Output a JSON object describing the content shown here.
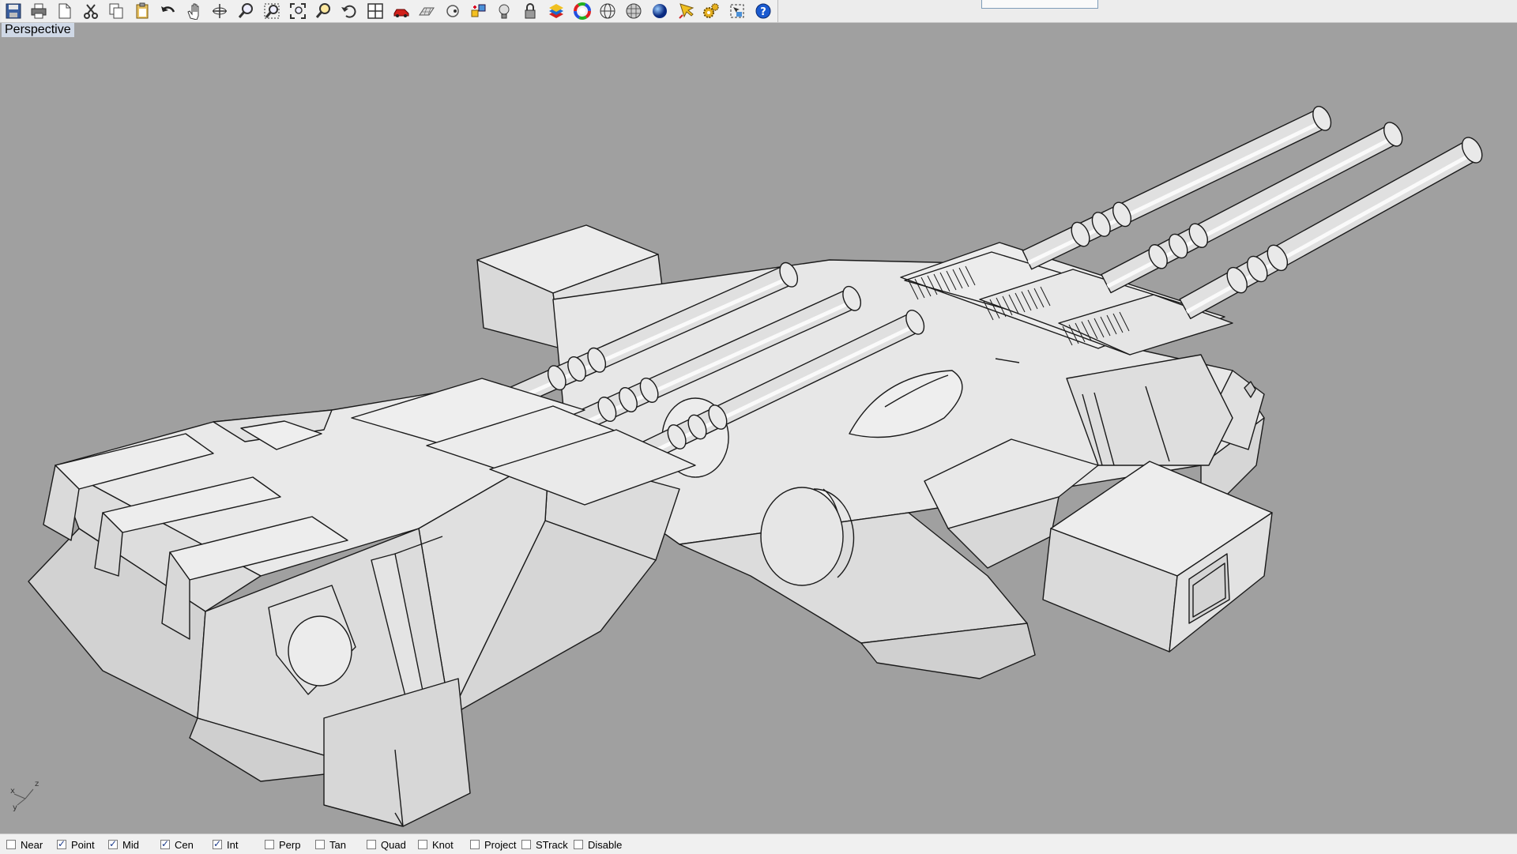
{
  "toolbar": {
    "icons": [
      "save-icon",
      "print-icon",
      "new-layout-icon",
      "cut-icon",
      "copy-icon",
      "paste-icon",
      "undo-icon",
      "pan-hand-icon",
      "rotate-view-icon",
      "zoom-dynamic-icon",
      "zoom-window-icon",
      "zoom-extents-icon",
      "zoom-selected-icon",
      "undo-view-icon",
      "four-viewports-icon",
      "car-icon",
      "grid-plane-icon",
      "circle-point-icon",
      "snap-grid-icon",
      "light-bulb-icon",
      "lock-icon",
      "layer-stack-icon",
      "color-wheel-icon",
      "sphere-wire-icon",
      "globe-mesh-icon",
      "render-sphere-icon",
      "pointer-wand-icon",
      "gear-cluster-icon",
      "selection-frame-icon",
      "help-icon"
    ]
  },
  "viewport": {
    "label": "Perspective"
  },
  "axis": {
    "x": "x",
    "y": "y",
    "z": "z"
  },
  "status": {
    "osnaps": [
      {
        "label": "Near",
        "checked": false
      },
      {
        "label": "Point",
        "checked": true
      },
      {
        "label": "Mid",
        "checked": true
      },
      {
        "label": "Cen",
        "checked": true
      },
      {
        "label": "Int",
        "checked": true
      },
      {
        "label": "Perp",
        "checked": false
      },
      {
        "label": "Tan",
        "checked": false
      },
      {
        "label": "Quad",
        "checked": false
      },
      {
        "label": "Knot",
        "checked": false
      },
      {
        "label": "Project",
        "checked": false
      },
      {
        "label": "STrack",
        "checked": false
      },
      {
        "label": "Disable",
        "checked": false
      }
    ]
  }
}
